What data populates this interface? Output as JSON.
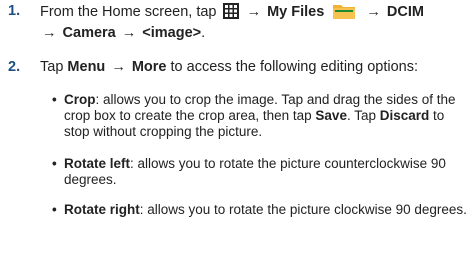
{
  "steps": [
    {
      "number": "1.",
      "parts": {
        "p1": "From the Home screen, tap",
        "arrow": "→",
        "my_files": "My Files",
        "dcim": "DCIM",
        "camera": "Camera",
        "image": "<image>",
        "end": "."
      }
    },
    {
      "number": "2.",
      "parts": {
        "p1": "Tap",
        "menu": "Menu",
        "arrow": "→",
        "more": "More",
        "p2": "to access the following editing options:"
      }
    }
  ],
  "bullets": [
    {
      "term": "Crop",
      "l1a": ": allows you to crop the image. Tap and drag the sides of the",
      "l2a": "crop box to create the crop area, then tap",
      "save": "Save",
      "l2b": ". Tap",
      "discard": "Discard",
      "l2c": "to",
      "l3": "stop without cropping the picture."
    },
    {
      "term": "Rotate left",
      "l1a": ": allows you to rotate the picture counterclockwise 90",
      "l2": "degrees."
    },
    {
      "term": "Rotate right",
      "l1a": ": allows you to rotate the picture clockwise 90 degrees."
    }
  ],
  "bullet_glyph": "•",
  "colors": {
    "step_number": "#1c4f80",
    "folder": "#f2b134"
  },
  "icons": {
    "apps": "apps-grid-icon",
    "folder": "folder-icon"
  }
}
